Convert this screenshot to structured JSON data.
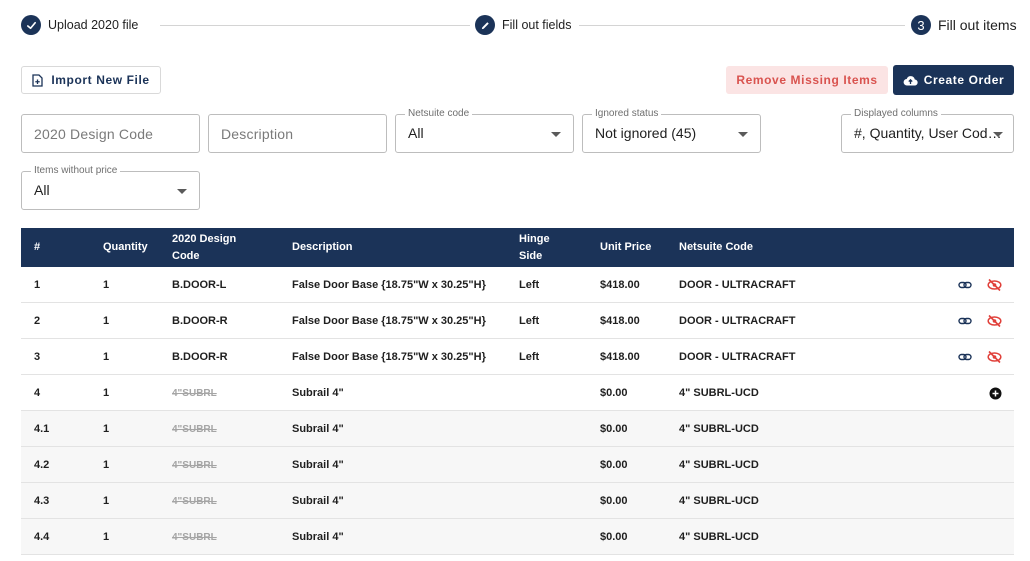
{
  "stepper": {
    "steps": [
      {
        "label": "Upload 2020 file",
        "icon": "check-icon"
      },
      {
        "label": "Fill out fields",
        "icon": "pencil-icon"
      },
      {
        "label": "Fill out items",
        "number": "3"
      }
    ]
  },
  "toolbar": {
    "import_label": "Import New File",
    "remove_label": "Remove Missing Items",
    "create_label": "Create Order"
  },
  "filters": {
    "design_code_placeholder": "2020 Design Code",
    "description_placeholder": "Description",
    "netsuite_label": "Netsuite code",
    "netsuite_value": "All",
    "ignored_label": "Ignored status",
    "ignored_value": "Not ignored (45)",
    "columns_label": "Displayed columns",
    "columns_value": "#, Quantity, User Cod…",
    "without_price_label": "Items without price",
    "without_price_value": "All"
  },
  "table": {
    "headers": {
      "num": "#",
      "quantity": "Quantity",
      "design_code_1": "2020 Design",
      "design_code_2": "Code",
      "description": "Description",
      "hinge_1": "Hinge",
      "hinge_2": "Side",
      "unit_price": "Unit Price",
      "netsuite": "Netsuite Code"
    },
    "rows": [
      {
        "num": "1",
        "qty": "1",
        "code": "B.DOOR-L",
        "desc": "False Door Base {18.75\"W x 30.25\"H}",
        "hinge": "Left",
        "price": "$418.00",
        "netsuite": "DOOR - ULTRACRAFT"
      },
      {
        "num": "2",
        "qty": "1",
        "code": "B.DOOR-R",
        "desc": "False Door Base {18.75\"W x 30.25\"H}",
        "hinge": "Left",
        "price": "$418.00",
        "netsuite": "DOOR - ULTRACRAFT"
      },
      {
        "num": "3",
        "qty": "1",
        "code": "B.DOOR-R",
        "desc": "False Door Base {18.75\"W x 30.25\"H}",
        "hinge": "Left",
        "price": "$418.00",
        "netsuite": "DOOR - ULTRACRAFT"
      },
      {
        "num": "4",
        "qty": "1",
        "code": "4\"SUBRL",
        "desc": "Subrail 4\"",
        "hinge": "",
        "price": "$0.00",
        "netsuite": "4\" SUBRL-UCD"
      },
      {
        "num": "4.1",
        "qty": "1",
        "code": "4\"SUBRL",
        "desc": "Subrail 4\"",
        "hinge": "",
        "price": "$0.00",
        "netsuite": "4\" SUBRL-UCD"
      },
      {
        "num": "4.2",
        "qty": "1",
        "code": "4\"SUBRL",
        "desc": "Subrail 4\"",
        "hinge": "",
        "price": "$0.00",
        "netsuite": "4\" SUBRL-UCD"
      },
      {
        "num": "4.3",
        "qty": "1",
        "code": "4\"SUBRL",
        "desc": "Subrail 4\"",
        "hinge": "",
        "price": "$0.00",
        "netsuite": "4\" SUBRL-UCD"
      },
      {
        "num": "4.4",
        "qty": "1",
        "code": "4\"SUBRL",
        "desc": "Subrail 4\"",
        "hinge": "",
        "price": "$0.00",
        "netsuite": "4\" SUBRL-UCD"
      }
    ]
  },
  "colors": {
    "primary": "#1b3358",
    "danger": "#e0403a",
    "danger_bg": "#fbe4e4"
  }
}
